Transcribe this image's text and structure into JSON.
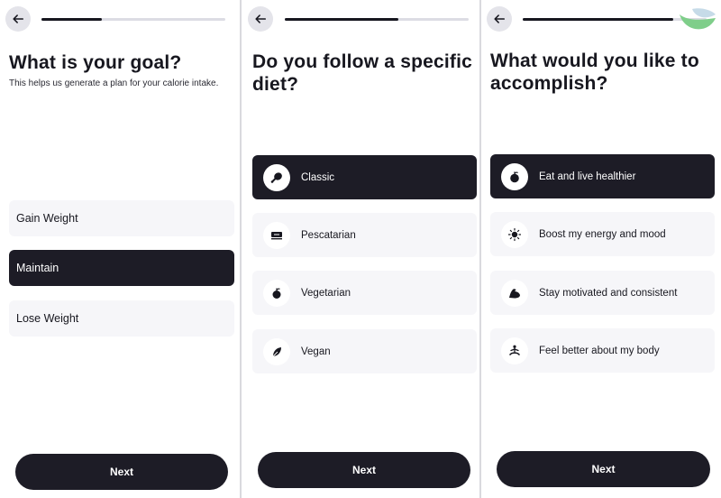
{
  "screens": [
    {
      "progress": 0.33,
      "title": "What is your goal?",
      "subtitle": "This helps us generate a plan for your calorie intake.",
      "options": [
        {
          "label": "Gain Weight",
          "selected": false
        },
        {
          "label": "Maintain",
          "selected": true
        },
        {
          "label": "Lose Weight",
          "selected": false
        }
      ],
      "next_label": "Next"
    },
    {
      "progress": 0.62,
      "title": "Do you follow a specific diet?",
      "options": [
        {
          "label": "Classic",
          "icon": "drumstick-icon",
          "selected": true
        },
        {
          "label": "Pescatarian",
          "icon": "fish-icon",
          "selected": false
        },
        {
          "label": "Vegetarian",
          "icon": "apple-icon",
          "selected": false
        },
        {
          "label": "Vegan",
          "icon": "leaf-icon",
          "selected": false
        }
      ],
      "next_label": "Next"
    },
    {
      "progress": 0.82,
      "title": "What would you like to accomplish?",
      "options": [
        {
          "label": "Eat and live healthier",
          "icon": "apple-icon",
          "selected": true
        },
        {
          "label": "Boost my energy and mood",
          "icon": "sun-icon",
          "selected": false
        },
        {
          "label": "Stay motivated and consistent",
          "icon": "flexed-arm-icon",
          "selected": false
        },
        {
          "label": "Feel better about my body",
          "icon": "meditation-icon",
          "selected": false
        }
      ],
      "next_label": "Next"
    }
  ],
  "colors": {
    "dark": "#1d1c26",
    "option_bg": "#f6f6f9",
    "track": "#dcdce4",
    "logo_green": "#7fce8a",
    "logo_blue": "#c6dbe8"
  }
}
